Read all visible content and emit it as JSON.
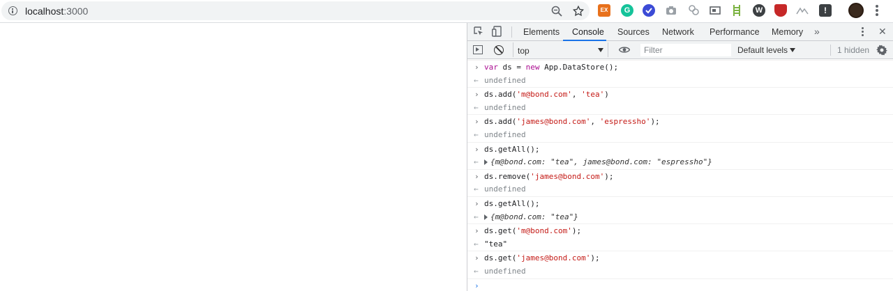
{
  "browser": {
    "url_host": "localhost",
    "url_port": ":3000",
    "extensions": {
      "ex_label": "EX",
      "g_label": "G",
      "w_label": "W",
      "exclam_label": "!"
    }
  },
  "devtools": {
    "tabs": [
      "Elements",
      "Console",
      "Sources",
      "Network",
      "Performance",
      "Memory"
    ],
    "active_tab": "Console",
    "more_tabs": "»",
    "close": "✕",
    "toolbar": {
      "context": "top",
      "filter_placeholder": "Filter",
      "levels": "Default levels",
      "hidden": "1 hidden"
    },
    "console": [
      {
        "kind": "input",
        "parts": [
          {
            "c": "kw",
            "t": "var"
          },
          {
            "c": "",
            "t": " ds = "
          },
          {
            "c": "kw",
            "t": "new"
          },
          {
            "c": "",
            "t": " App.DataStore();"
          }
        ]
      },
      {
        "kind": "output",
        "parts": [
          {
            "c": "undef",
            "t": "undefined"
          }
        ]
      },
      {
        "kind": "input",
        "parts": [
          {
            "c": "",
            "t": "ds.add("
          },
          {
            "c": "str",
            "t": "'m@bond.com'"
          },
          {
            "c": "",
            "t": ", "
          },
          {
            "c": "str",
            "t": "'tea'"
          },
          {
            "c": "",
            "t": ")"
          }
        ]
      },
      {
        "kind": "output",
        "parts": [
          {
            "c": "undef",
            "t": "undefined"
          }
        ]
      },
      {
        "kind": "input",
        "parts": [
          {
            "c": "",
            "t": "ds.add("
          },
          {
            "c": "str",
            "t": "'james@bond.com'"
          },
          {
            "c": "",
            "t": ", "
          },
          {
            "c": "str",
            "t": "'espressho'"
          },
          {
            "c": "",
            "t": ");"
          }
        ]
      },
      {
        "kind": "output",
        "parts": [
          {
            "c": "undef",
            "t": "undefined"
          }
        ]
      },
      {
        "kind": "input",
        "parts": [
          {
            "c": "",
            "t": "ds.getAll();"
          }
        ]
      },
      {
        "kind": "object",
        "parts": [
          {
            "c": "obj",
            "t": "{m@bond.com: "
          },
          {
            "c": "objstr",
            "t": "\"tea\""
          },
          {
            "c": "obj",
            "t": ", james@bond.com: "
          },
          {
            "c": "objstr",
            "t": "\"espressho\""
          },
          {
            "c": "obj",
            "t": "}"
          }
        ]
      },
      {
        "kind": "input",
        "parts": [
          {
            "c": "",
            "t": "ds.remove("
          },
          {
            "c": "str",
            "t": "'james@bond.com'"
          },
          {
            "c": "",
            "t": ");"
          }
        ]
      },
      {
        "kind": "output",
        "parts": [
          {
            "c": "undef",
            "t": "undefined"
          }
        ]
      },
      {
        "kind": "input",
        "parts": [
          {
            "c": "",
            "t": "ds.getAll();"
          }
        ]
      },
      {
        "kind": "object",
        "parts": [
          {
            "c": "obj",
            "t": "{m@bond.com: "
          },
          {
            "c": "objstr",
            "t": "\"tea\""
          },
          {
            "c": "obj",
            "t": "}"
          }
        ]
      },
      {
        "kind": "input",
        "parts": [
          {
            "c": "",
            "t": "ds.get("
          },
          {
            "c": "str",
            "t": "'m@bond.com'"
          },
          {
            "c": "",
            "t": ");"
          }
        ]
      },
      {
        "kind": "output",
        "parts": [
          {
            "c": "",
            "t": "\"tea\""
          }
        ]
      },
      {
        "kind": "input",
        "parts": [
          {
            "c": "",
            "t": "ds.get("
          },
          {
            "c": "str",
            "t": "'james@bond.com'"
          },
          {
            "c": "",
            "t": ");"
          }
        ]
      },
      {
        "kind": "output",
        "parts": [
          {
            "c": "undef",
            "t": "undefined"
          }
        ]
      },
      {
        "kind": "prompt",
        "parts": []
      }
    ]
  },
  "colors": {
    "string": "#c41a16",
    "keyword": "#aa0d91",
    "accent": "#1a73e8",
    "muted": "#80868b"
  }
}
